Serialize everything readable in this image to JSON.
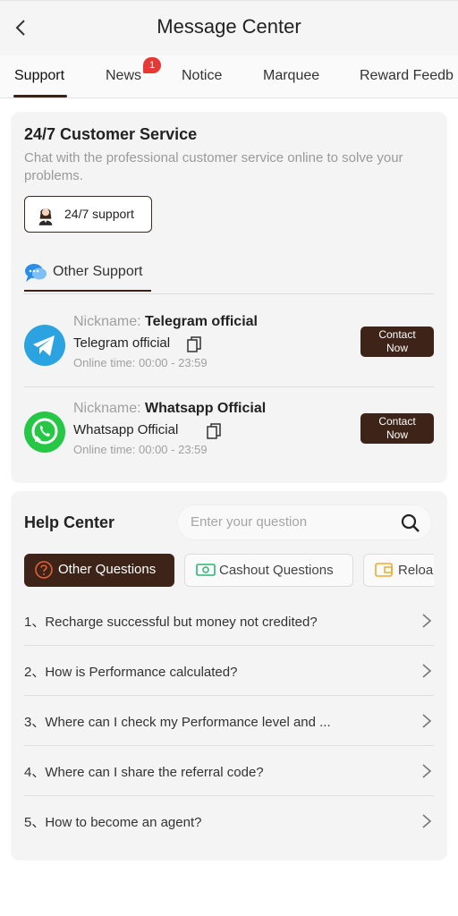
{
  "header": {
    "title": "Message Center"
  },
  "tabs": [
    {
      "label": "Support"
    },
    {
      "label": "News",
      "badge": "1"
    },
    {
      "label": "Notice"
    },
    {
      "label": "Marquee"
    },
    {
      "label": "Reward Feedb"
    }
  ],
  "customer_service": {
    "title": "24/7 Customer Service",
    "description": "Chat with the professional customer service online to solve your problems.",
    "button_label": "24/7 support"
  },
  "other_support": {
    "label": "Other Support",
    "contacts": [
      {
        "nickname_label": "Nickname:",
        "nickname": "Telegram official",
        "account": "Telegram official",
        "online_label": "Online time:",
        "online_time": "00:00 - 23:59",
        "button_line1": "Contact",
        "button_line2": "Now",
        "icon": "telegram-icon"
      },
      {
        "nickname_label": "Nickname:",
        "nickname": "Whatsapp Official",
        "account": "Whatsapp Official",
        "online_label": "Online time:",
        "online_time": "00:00 - 23:59",
        "button_line1": "Contact",
        "button_line2": "Now",
        "icon": "whatsapp-icon"
      }
    ]
  },
  "help_center": {
    "title": "Help Center",
    "search_placeholder": "Enter your question",
    "categories": [
      {
        "label": "Other Questions",
        "icon": "question-circle-icon"
      },
      {
        "label": "Cashout Questions",
        "icon": "cash-icon"
      },
      {
        "label": "Reloa",
        "icon": "wallet-icon"
      }
    ],
    "questions": [
      {
        "text": "1、Recharge successful but money not credited?"
      },
      {
        "text": "2、How is Performance calculated?"
      },
      {
        "text": "3、Where can I check my Performance level and ..."
      },
      {
        "text": "4、Where can I share the referral code?"
      },
      {
        "text": "5、How to become an agent?"
      }
    ]
  },
  "colors": {
    "accent": "#3d2318",
    "badge": "#e53935",
    "telegram": "#2aa3e0",
    "whatsapp": "#25c744"
  }
}
